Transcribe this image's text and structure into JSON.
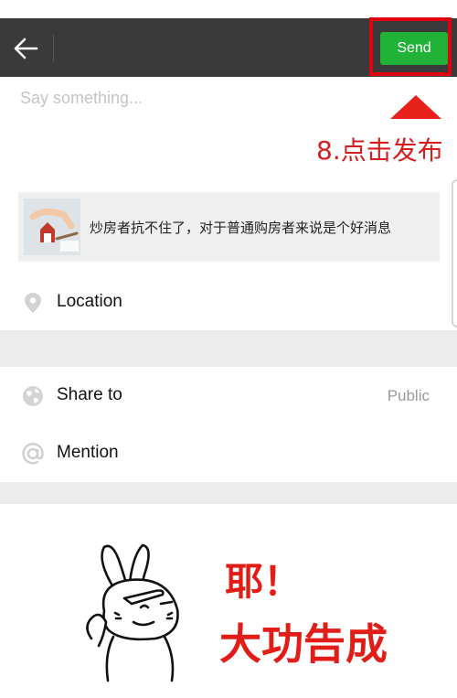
{
  "header": {
    "back_icon": "arrow-left-icon",
    "send_label": "Send",
    "bar_color": "#3a3a3a",
    "send_color": "#20b338",
    "highlight_color": "#e0000f"
  },
  "composer": {
    "placeholder": "Say something..."
  },
  "annotation": {
    "step_label": "8.点击发布",
    "color": "#d51e1e"
  },
  "shared_article": {
    "title": "炒房者抗不住了，对于普通购房者来说是个好消息",
    "thumbnail_icon": "house-model-thumbnail"
  },
  "options": {
    "location": {
      "label": "Location",
      "icon": "location-pin-icon"
    },
    "share_to": {
      "label": "Share to",
      "value": "Public",
      "icon": "globe-icon"
    },
    "mention": {
      "label": "Mention",
      "icon": "at-sign-icon"
    }
  },
  "sticker": {
    "line1": "耶！",
    "line2": "大功告成",
    "illustration": "bunny-salute-sticker"
  }
}
